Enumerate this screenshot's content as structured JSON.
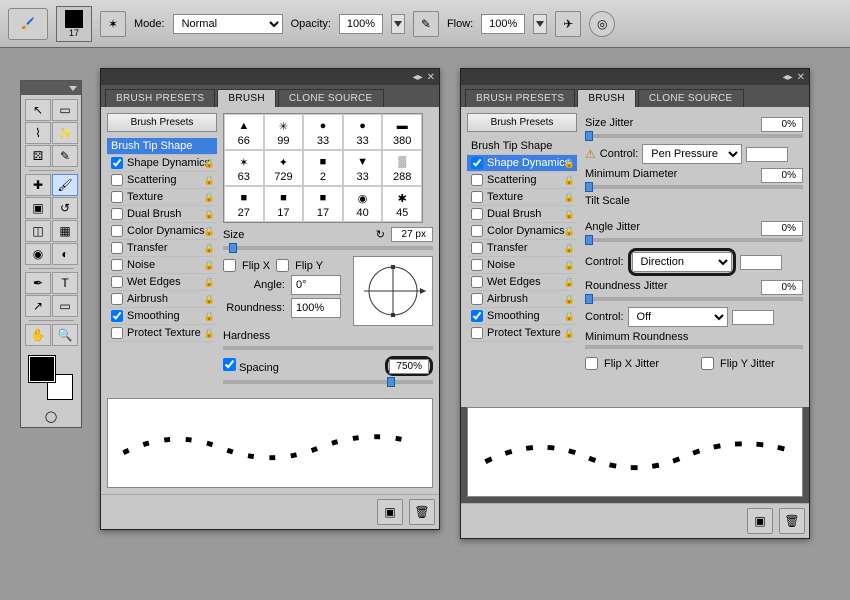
{
  "topbar": {
    "size": "17",
    "mode_label": "Mode:",
    "mode_value": "Normal",
    "opacity_label": "Opacity:",
    "opacity_value": "100%",
    "flow_label": "Flow:",
    "flow_value": "100%"
  },
  "tabs": {
    "presets": "BRUSH PRESETS",
    "brush": "BRUSH",
    "clone": "CLONE SOURCE"
  },
  "left": {
    "presets_btn": "Brush Presets",
    "opts": [
      {
        "label": "Brush Tip Shape",
        "checked": false,
        "hilite": true,
        "cb": false
      },
      {
        "label": "Shape Dynamics",
        "checked": true
      },
      {
        "label": "Scattering",
        "checked": false
      },
      {
        "label": "Texture",
        "checked": false
      },
      {
        "label": "Dual Brush",
        "checked": false
      },
      {
        "label": "Color Dynamics",
        "checked": false
      },
      {
        "label": "Transfer",
        "checked": false
      },
      {
        "label": "Noise",
        "checked": false
      },
      {
        "label": "Wet Edges",
        "checked": false
      },
      {
        "label": "Airbrush",
        "checked": false
      },
      {
        "label": "Smoothing",
        "checked": true
      },
      {
        "label": "Protect Texture",
        "checked": false
      }
    ]
  },
  "tip": {
    "thumbs": [
      [
        "66",
        "99",
        "33",
        "33",
        "380"
      ],
      [
        "63",
        "729",
        "2",
        "33",
        "288"
      ],
      [
        "27",
        "17",
        "17",
        "40",
        "45"
      ]
    ],
    "size_label": "Size",
    "size_value": "27 px",
    "flipx": "Flip X",
    "flipy": "Flip Y",
    "angle_label": "Angle:",
    "angle_value": "0°",
    "round_label": "Roundness:",
    "round_value": "100%",
    "hardness_label": "Hardness",
    "spacing_label": "Spacing",
    "spacing_value": "750%"
  },
  "dyn": {
    "size_jitter": "Size Jitter",
    "sj_val": "0%",
    "control": "Control:",
    "pen": "Pen Pressure",
    "min_diam": "Minimum Diameter",
    "md_val": "0%",
    "tilt": "Tilt Scale",
    "angle_jitter": "Angle Jitter",
    "aj_val": "0%",
    "direction": "Direction",
    "round_jitter": "Roundness Jitter",
    "rj_val": "0%",
    "off": "Off",
    "min_round": "Minimum Roundness",
    "flipxj": "Flip X Jitter",
    "flipyj": "Flip Y Jitter"
  }
}
